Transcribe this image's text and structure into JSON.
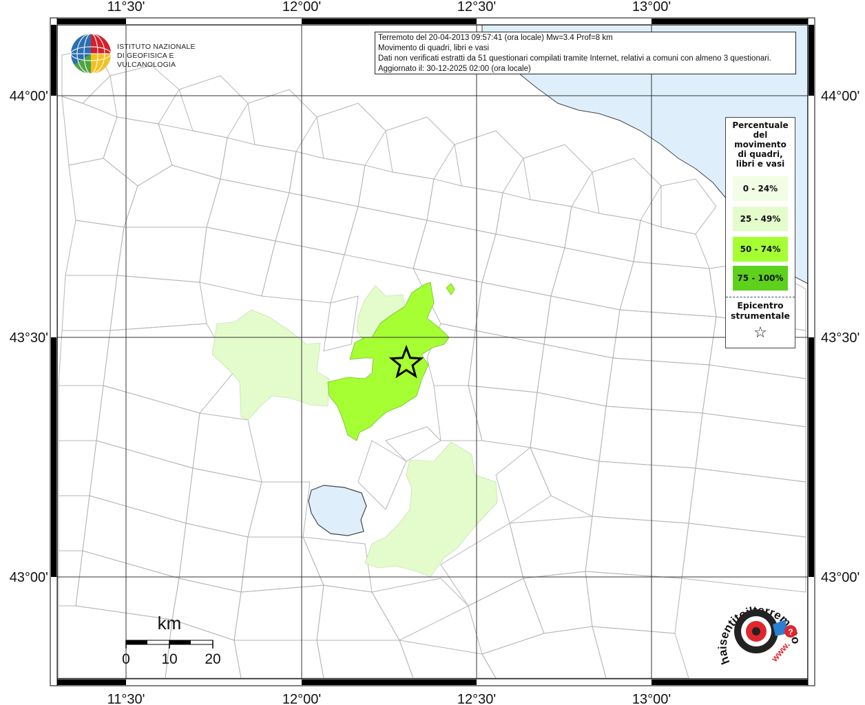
{
  "header": {
    "line1": "Terremoto del 20-04-2013 09:57:41 (ora locale) Mw=3.4 Prof=8 km",
    "line2": "Movimento di quadri, libri e vasi",
    "line3": "Dati non verificati estratti da 51 questionari compilati tramite Internet, relativi a comuni con almeno 3 questionari.",
    "line4": "Aggiornato il: 30-12-2025 02:00 (ora locale)"
  },
  "logo": {
    "org_line1": "ISTITUTO NAZIONALE",
    "org_line2": "DI GEOFISICA E VULCANOLOGIA"
  },
  "axes": {
    "lon_ticks": [
      "11°30'",
      "12°00'",
      "12°30'",
      "13°00'"
    ],
    "lat_ticks": [
      "44°00'",
      "43°30'",
      "43°00'"
    ]
  },
  "legend": {
    "title_lines": [
      "Percentuale",
      "del",
      "movimento",
      "di quadri,",
      "libri e vasi"
    ],
    "classes": [
      {
        "label": "0 - 24%",
        "color": "#f2fde6"
      },
      {
        "label": "25 - 49%",
        "color": "#e4fccc"
      },
      {
        "label": "50 - 74%",
        "color": "#a6ff33"
      },
      {
        "label": "75 - 100%",
        "color": "#5ed11c"
      }
    ],
    "epicenter_line1": "Epicentro",
    "epicenter_line2": "strumentale",
    "epicenter_symbol": "☆"
  },
  "scalebar": {
    "unit": "km",
    "ticks": [
      "0",
      "10",
      "20"
    ]
  },
  "colors": {
    "sea": "#deeffb",
    "lake": "#deeffb",
    "class_low": "#e4fccc",
    "class_mid": "#a6ff33",
    "boundary": "#b5b5b5"
  },
  "site_logo": {
    "text": "haisentitoilterremoto.it",
    "url_text": "www."
  }
}
